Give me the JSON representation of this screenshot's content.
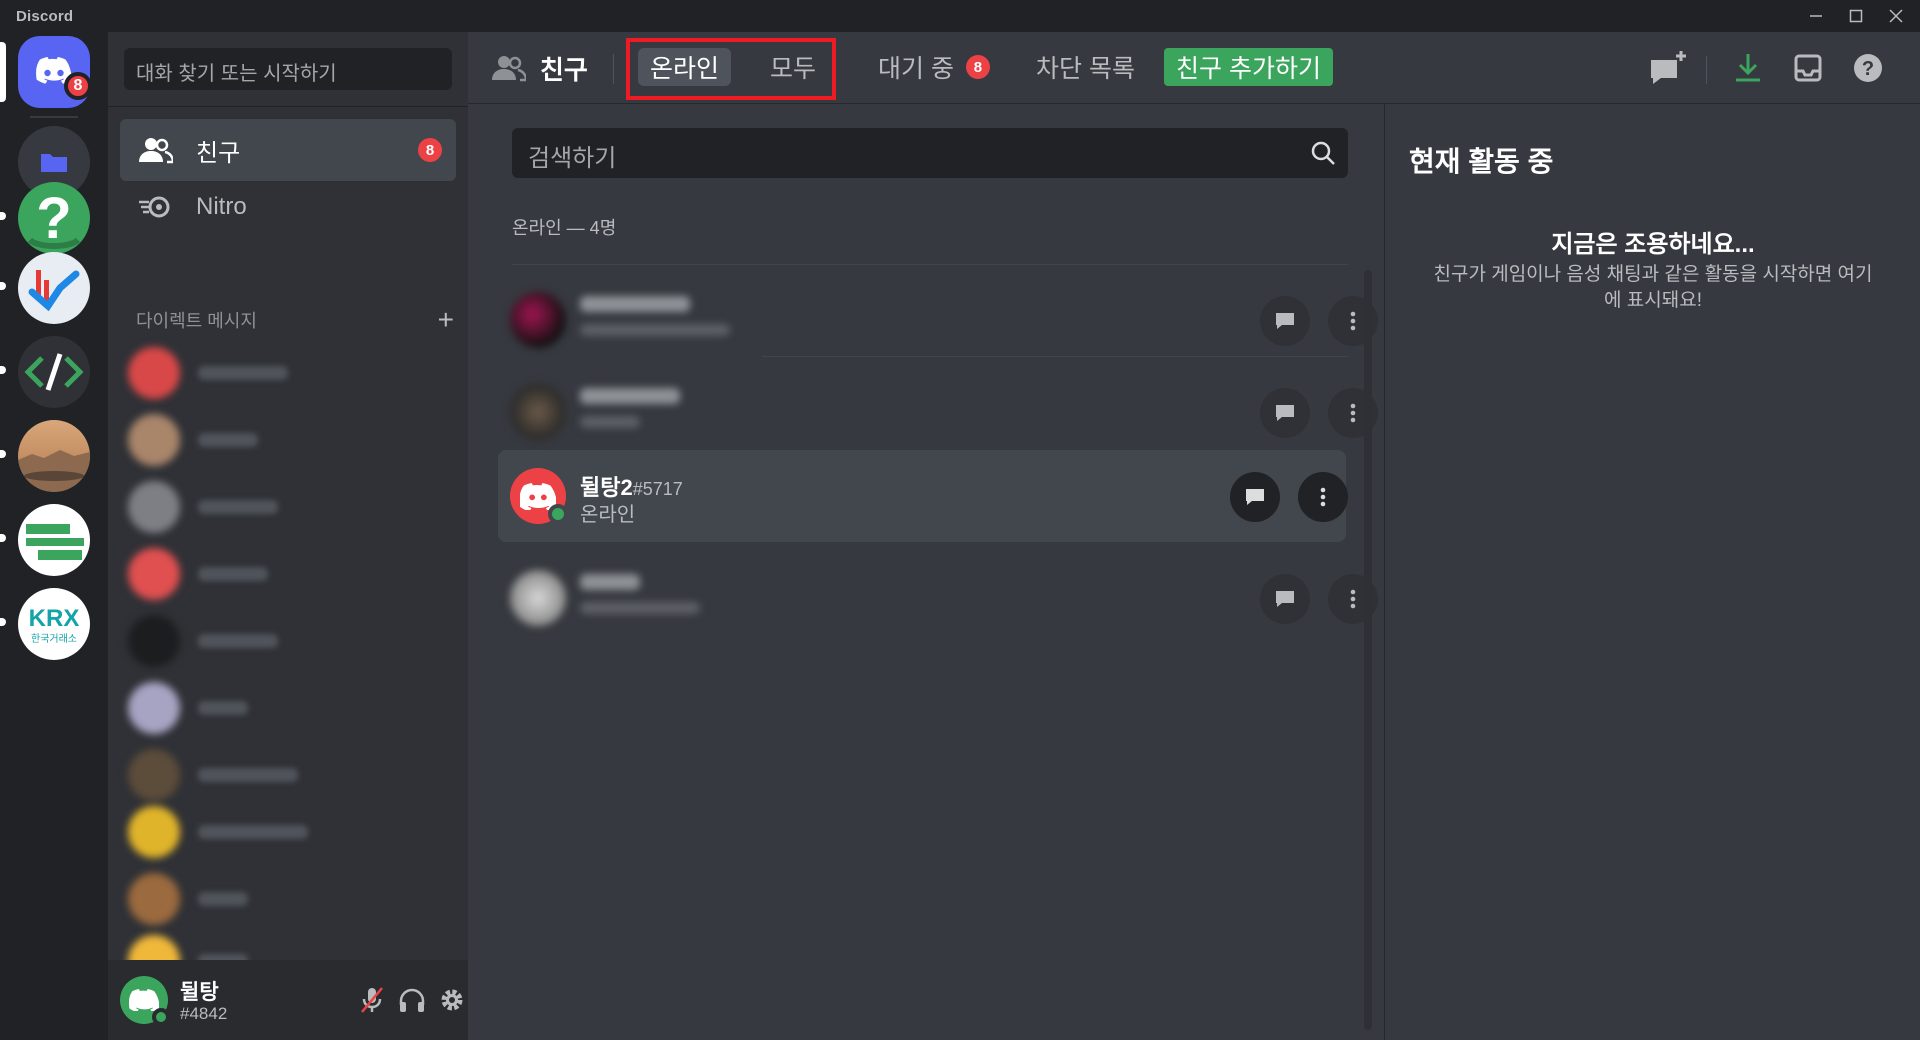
{
  "window": {
    "app_name": "Discord"
  },
  "servers": {
    "home_badge": "8"
  },
  "sidebar": {
    "search_placeholder": "대화 찾기 또는 시작하기",
    "nav": [
      {
        "label": "친구",
        "badge": "8"
      },
      {
        "label": "Nitro"
      }
    ],
    "dm_header": "다이렉트 메시지",
    "dm_add": "+"
  },
  "user_panel": {
    "name": "뒬탕",
    "tag": "#4842"
  },
  "topbar": {
    "title": "친구",
    "tabs": [
      {
        "label": "온라인"
      },
      {
        "label": "모두"
      },
      {
        "label": "대기 중",
        "badge": "8"
      },
      {
        "label": "차단 목록"
      }
    ],
    "add_friend": "친구 추가하기"
  },
  "friends": {
    "search_placeholder": "검색하기",
    "online_count": "온라인 — 4명",
    "visible_friend": {
      "name": "뒬탕2",
      "tag": "#5717",
      "status": "온라인"
    }
  },
  "activity": {
    "title": "현재 활동 중",
    "quiet": "지금은 조용하네요...",
    "description": "친구가 게임이나 음성 채팅과 같은 활동을 시작하면 여기에 표시돼요!"
  },
  "colors": {
    "blurple": "#5865f2",
    "green": "#3ba55d",
    "red": "#ed4245"
  }
}
